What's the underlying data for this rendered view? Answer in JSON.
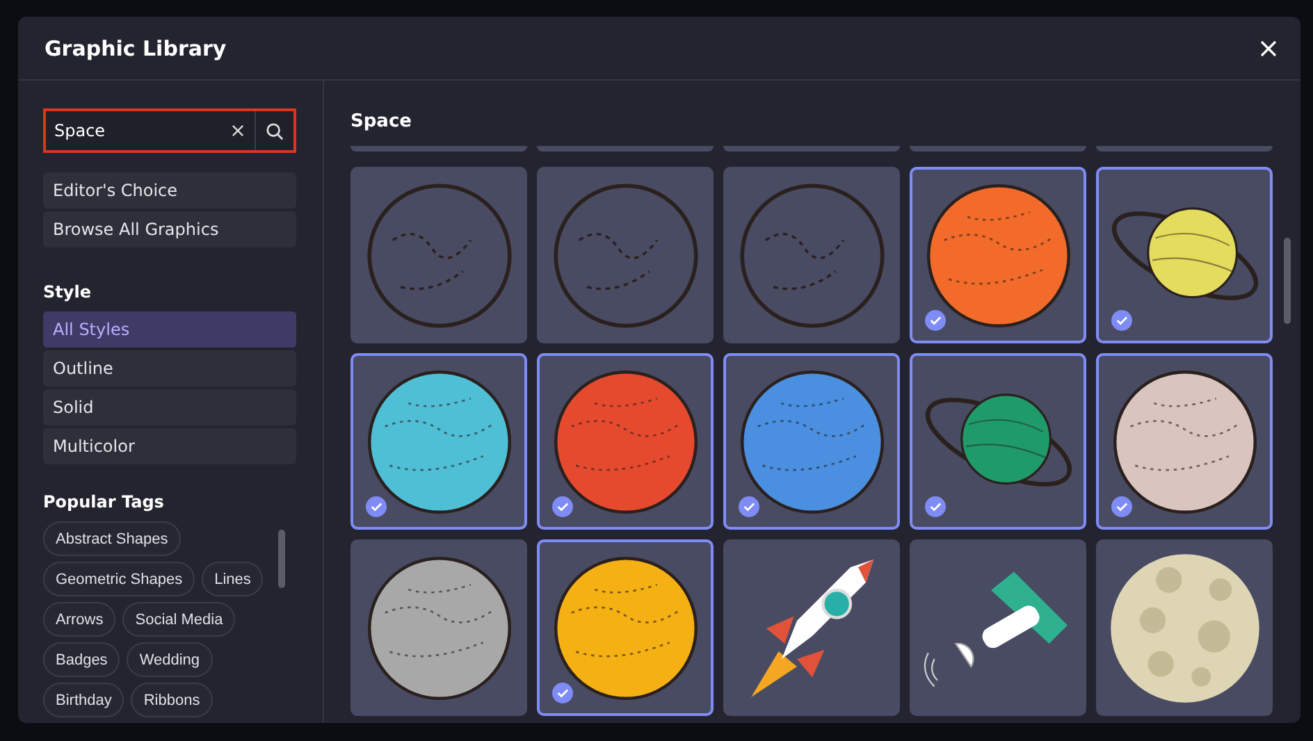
{
  "dialog": {
    "title": "Graphic Library"
  },
  "search": {
    "value": "Space"
  },
  "shortcuts": [
    {
      "label": "Editor's Choice"
    },
    {
      "label": "Browse All Graphics"
    }
  ],
  "style": {
    "heading": "Style",
    "options": [
      {
        "label": "All Styles",
        "selected": true
      },
      {
        "label": "Outline",
        "selected": false
      },
      {
        "label": "Solid",
        "selected": false
      },
      {
        "label": "Multicolor",
        "selected": false
      }
    ]
  },
  "popular_tags": {
    "heading": "Popular Tags",
    "tags": [
      "Abstract Shapes",
      "Geometric Shapes",
      "Lines",
      "Arrows",
      "Social Media",
      "Badges",
      "Wedding",
      "Birthday",
      "Ribbons"
    ]
  },
  "results": {
    "heading": "Space",
    "tiles": [
      {
        "kind": "outline-planet",
        "selected": false
      },
      {
        "kind": "outline-planet",
        "selected": false
      },
      {
        "kind": "outline-planet",
        "selected": false
      },
      {
        "kind": "planet",
        "color": "#f26b2a",
        "selected": true
      },
      {
        "kind": "ringed-planet",
        "color": "#e3dc5c",
        "selected": true
      },
      {
        "kind": "planet",
        "color": "#4fbfd6",
        "selected": true
      },
      {
        "kind": "planet",
        "color": "#e64a2e",
        "selected": true
      },
      {
        "kind": "planet",
        "color": "#4a8fe0",
        "selected": true
      },
      {
        "kind": "ringed-planet",
        "color": "#1f9a6a",
        "selected": true
      },
      {
        "kind": "planet",
        "color": "#d9c4c0",
        "selected": true
      },
      {
        "kind": "planet",
        "color": "#a8a8a8",
        "selected": false
      },
      {
        "kind": "planet",
        "color": "#f5b014",
        "selected": true
      },
      {
        "kind": "rocket",
        "selected": false
      },
      {
        "kind": "satellite",
        "selected": false
      },
      {
        "kind": "moon",
        "selected": false
      }
    ]
  }
}
